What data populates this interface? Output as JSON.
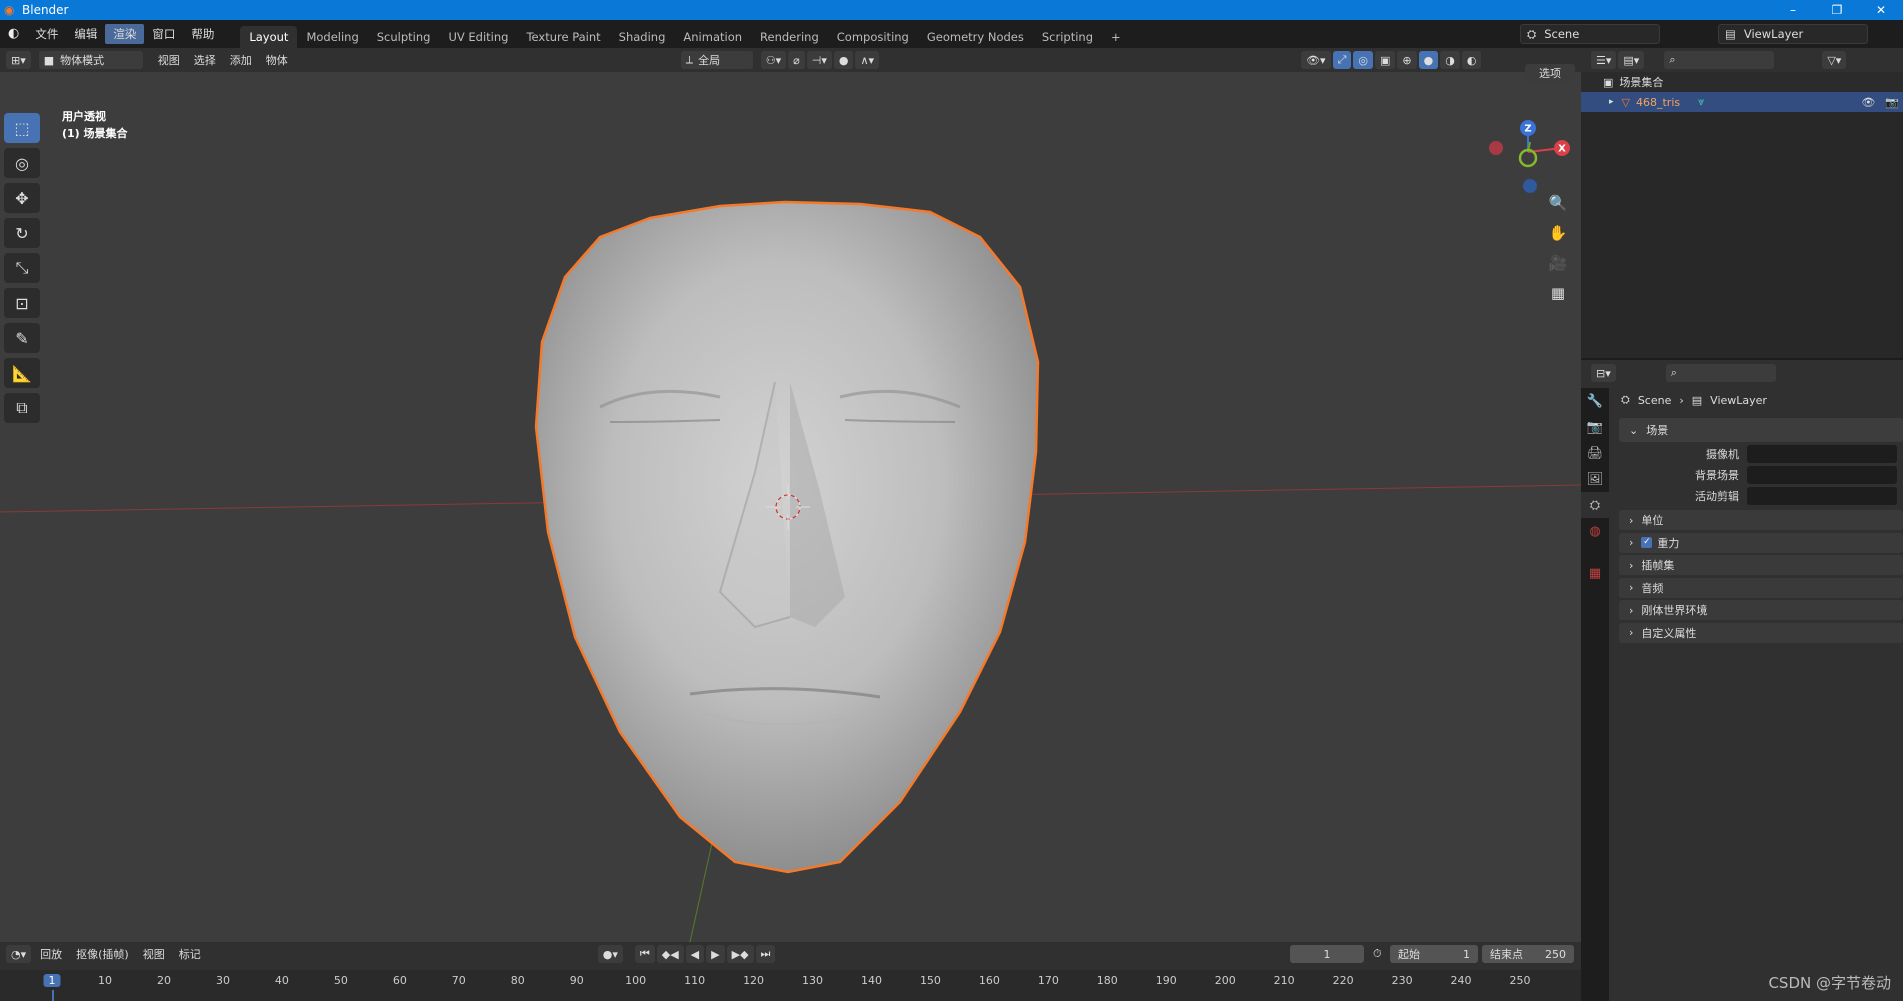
{
  "window": {
    "title": "Blender",
    "minimize": "–",
    "restore": "❐",
    "close": "✕"
  },
  "menu": {
    "items": [
      "文件",
      "编辑",
      "渲染",
      "窗口",
      "帮助"
    ],
    "active_index": 2
  },
  "workspaces": [
    "Layout",
    "Modeling",
    "Sculpting",
    "UV Editing",
    "Texture Paint",
    "Shading",
    "Animation",
    "Rendering",
    "Compositing",
    "Geometry Nodes",
    "Scripting",
    "+"
  ],
  "scene": {
    "name": "Scene",
    "view_layer": "ViewLayer"
  },
  "header": {
    "mode": "物体模式",
    "menus": [
      "视图",
      "选择",
      "添加",
      "物体"
    ],
    "transform": "全局",
    "options": "选项"
  },
  "viewport": {
    "perspective": "用户透视",
    "collection": "(1) 场景集合"
  },
  "gizmo": {
    "x": "X",
    "y": "Y",
    "z": "Z"
  },
  "outliner": {
    "root": "场景集合",
    "object": "468_tris"
  },
  "properties": {
    "breadcrumb_scene": "Scene",
    "breadcrumb_layer": "ViewLayer",
    "panel": "场景",
    "fields": [
      {
        "label": "摄像机"
      },
      {
        "label": "背景场景"
      },
      {
        "label": "活动剪辑"
      }
    ],
    "sections": [
      "单位",
      "重力",
      "插帧集",
      "音频",
      "刚体世界环境",
      "自定义属性"
    ]
  },
  "timeline": {
    "menus": [
      "回放",
      "抠像(插帧)",
      "视图",
      "标记"
    ],
    "current_frame": "1",
    "start_label": "起始",
    "start": "1",
    "end_label": "结束点",
    "end": "250",
    "ticks": [
      "1",
      "10",
      "20",
      "30",
      "40",
      "50",
      "60",
      "70",
      "80",
      "90",
      "100",
      "110",
      "120",
      "130",
      "140",
      "150",
      "160",
      "170",
      "180",
      "190",
      "200",
      "210",
      "220",
      "230",
      "240",
      "250"
    ]
  },
  "watermark": "CSDN @字节卷动",
  "colors": {
    "accent": "#4772b3",
    "selection": "#f5792a",
    "title_bar": "#0a78d7"
  }
}
